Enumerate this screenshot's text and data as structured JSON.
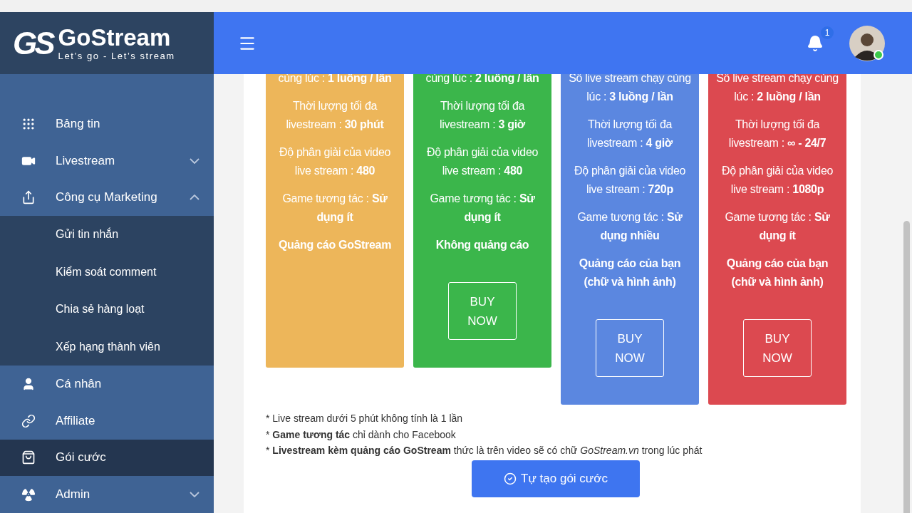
{
  "logo": {
    "mark": "GS",
    "name": "GoStream",
    "tagline": "Let’s go - Let’s stream"
  },
  "header": {
    "notifications": "1",
    "online": true
  },
  "sidebar": {
    "items": [
      {
        "label": "Bảng tin",
        "selected": false
      },
      {
        "label": "Livestream",
        "selected": false,
        "expanded": false
      },
      {
        "label": "Công cụ Marketing",
        "selected": false,
        "expanded": true,
        "children": [
          {
            "label": "Gửi tin nhắn"
          },
          {
            "label": "Kiểm soát comment"
          },
          {
            "label": "Chia sẻ hàng loạt"
          },
          {
            "label": "Xếp hạng thành viên"
          }
        ]
      },
      {
        "label": "Cá nhân",
        "selected": false
      },
      {
        "label": "Affiliate",
        "selected": false
      },
      {
        "label": "Gói cước",
        "selected": true
      },
      {
        "label": "Admin",
        "selected": false,
        "expanded": false
      }
    ]
  },
  "plans": [
    {
      "color": "#edb65a",
      "features": [
        "cùng lúc : **1 luồng / lần**",
        "Thời lượng tối đa livestream : **30 phút**",
        "Độ phân giải của video live stream : **480**",
        "Game tương tác : **Sử dụng ít**",
        "**Quảng cáo GoStream**"
      ]
    },
    {
      "color": "#3bb64b",
      "features": [
        "cùng lúc : **2 luồng / lần**",
        "Thời lượng tối đa livestream : **3 giờ**",
        "Độ phân giải của video live stream : **480**",
        "Game tương tác : **Sử dụng ít**",
        "**Không quảng cáo**"
      ],
      "button": "BUY NOW"
    },
    {
      "color": "#5b87e0",
      "features": [
        "Số live stream chạy cùng lúc : **3 luồng / lần**",
        "Thời lượng tối đa livestream : **4 giờ**",
        "Độ phân giải của video live stream : **720p**",
        "Game tương tác : **Sử dụng nhiều**",
        "**Quảng cáo của bạn (chữ và hình ảnh)**"
      ],
      "button": "BUY NOW"
    },
    {
      "color": "#dc4950",
      "features": [
        "Số live stream chạy cùng lúc : **2 luồng / lần**",
        "Thời lượng tối đa livestream : **∞ - 24/7**",
        "Độ phân giải của video live stream : **1080p**",
        "Game tương tác : **Sử dụng ít**",
        "**Quảng cáo của bạn (chữ và hình ảnh)**"
      ],
      "button": "BUY NOW"
    }
  ],
  "notes": [
    "* Live stream dưới 5 phút không tính là 1 lần",
    "* **Game tương tác** chỉ dành cho Facebook",
    "* **Livestream kèm quảng cáo GoStream** thức là trên video sẽ có chữ *GoStream.vn* trong lúc phát"
  ],
  "custom_button": "Tự tạo gói cước"
}
